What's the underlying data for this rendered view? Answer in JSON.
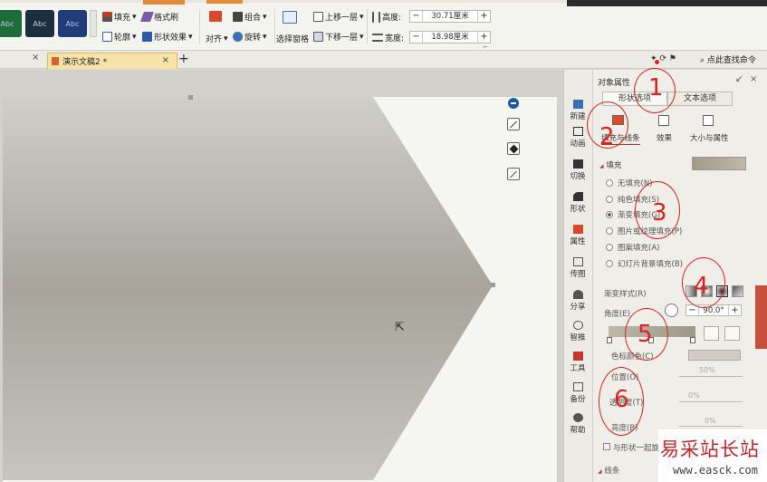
{
  "ribbon": {
    "style_swatch_label": "Abc",
    "fill": "填充",
    "format_brush": "格式刷",
    "outline": "轮廓",
    "shape_effect": "形状效果",
    "align": "对齐",
    "group": "组合",
    "rotate": "旋转",
    "selection_pane": "选择窗格",
    "bring_forward": "上移一层",
    "send_backward": "下移一层",
    "height_label": "高度:",
    "height_value": "30.71厘米",
    "width_label": "宽度:",
    "width_value": "18.98厘米",
    "minus": "−",
    "plus": "+",
    "search": "点此查找命令"
  },
  "tabs": {
    "close_glyph": "×",
    "document": "演示文稿2 *",
    "add_glyph": "+"
  },
  "sidebar": {
    "items": [
      "新建",
      "动画",
      "切换",
      "形状",
      "属性",
      "传图",
      "分享",
      "智推",
      "工具",
      "备份",
      "帮助"
    ]
  },
  "panel": {
    "title": "对象属性",
    "tab_shape": "形状选项",
    "tab_text": "文本选项",
    "sub_fill_line": "填充与线条",
    "sub_effect": "效果",
    "sub_size": "大小与属性",
    "fill_header": "填充",
    "fill_options": [
      "无填充(N)",
      "纯色填充(S)",
      "渐变填充(G)",
      "图片或纹理填充(P)",
      "图案填充(A)",
      "幻灯片背景填充(B)"
    ],
    "selected_fill_index": 2,
    "gradient_style_label": "渐变样式(R)",
    "angle_label": "角度(E)",
    "angle_value": "90.0°",
    "color_label": "色标颜色(C)",
    "position_label": "位置(O)",
    "position_value": "50%",
    "transparency_label": "透明度(T)",
    "transparency_value": "0%",
    "brightness_label": "亮度(B)",
    "brightness_value": "0%",
    "rotate_with_shape": "与形状一起旋转",
    "line_header": "线条"
  },
  "annotations": [
    "1",
    "2",
    "3",
    "4",
    "5",
    "6"
  ],
  "watermark": {
    "name": "易采站长站",
    "url": "www.easck.com"
  },
  "colors": {
    "annotation_red": "#e02020",
    "doc_tab": "#f7e3a8",
    "accent_orange": "#e08a3a"
  }
}
